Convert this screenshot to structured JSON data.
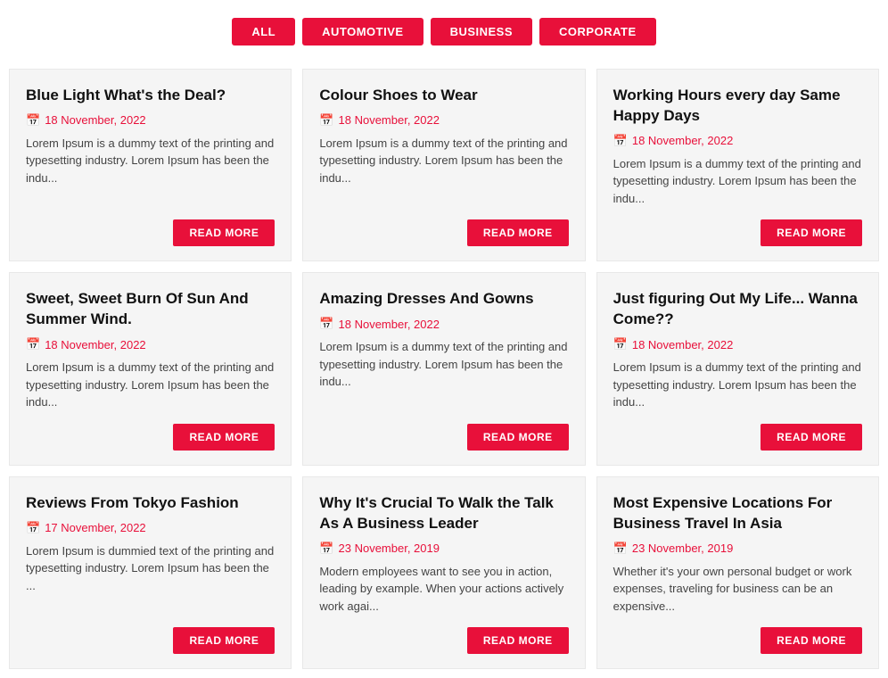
{
  "filters": [
    {
      "label": "ALL",
      "active": true
    },
    {
      "label": "AUTOMOTIVE",
      "active": false
    },
    {
      "label": "BUSINESS",
      "active": false
    },
    {
      "label": "CORPORATE",
      "active": false
    }
  ],
  "cards": [
    {
      "title": "Blue Light What's the Deal?",
      "date": "18 November, 2022",
      "excerpt": "Lorem Ipsum is a dummy text of the printing and typesetting industry. Lorem Ipsum has been the indu...",
      "read_more": "READ MORE"
    },
    {
      "title": "Colour Shoes to Wear",
      "date": "18 November, 2022",
      "excerpt": "Lorem Ipsum is a dummy text of the printing and typesetting industry. Lorem Ipsum has been the indu...",
      "read_more": "READ MORE"
    },
    {
      "title": "Working Hours every day Same Happy Days",
      "date": "18 November, 2022",
      "excerpt": "Lorem Ipsum is a dummy text of the printing and typesetting industry. Lorem Ipsum has been the indu...",
      "read_more": "READ MORE"
    },
    {
      "title": "Sweet, Sweet Burn Of Sun And Summer Wind.",
      "date": "18 November, 2022",
      "excerpt": "Lorem Ipsum is a dummy text of the printing and typesetting industry. Lorem Ipsum has been the indu...",
      "read_more": "READ MORE"
    },
    {
      "title": "Amazing Dresses And Gowns",
      "date": "18 November, 2022",
      "excerpt": "Lorem Ipsum is a dummy text of the printing and typesetting industry. Lorem Ipsum has been the indu...",
      "read_more": "READ MORE"
    },
    {
      "title": "Just figuring Out My Life... Wanna Come??",
      "date": "18 November, 2022",
      "excerpt": "Lorem Ipsum is a dummy text of the printing and typesetting industry. Lorem Ipsum has been the indu...",
      "read_more": "READ MORE"
    },
    {
      "title": "Reviews From Tokyo Fashion",
      "date": "17 November, 2022",
      "excerpt": "Lorem Ipsum is dummied text of the printing and typesetting industry. Lorem Ipsum has been the ...",
      "read_more": "READ MORE"
    },
    {
      "title": "Why It's Crucial To Walk the Talk As A Business Leader",
      "date": "23 November, 2019",
      "excerpt": "Modern employees want to see you in action, leading by example. When your actions actively work agai...",
      "read_more": "READ MORE"
    },
    {
      "title": "Most Expensive Locations For Business Travel In Asia",
      "date": "23 November, 2019",
      "excerpt": "Whether it's your own personal budget or work expenses, traveling for business can be an expensive...",
      "read_more": "READ MORE"
    }
  ]
}
